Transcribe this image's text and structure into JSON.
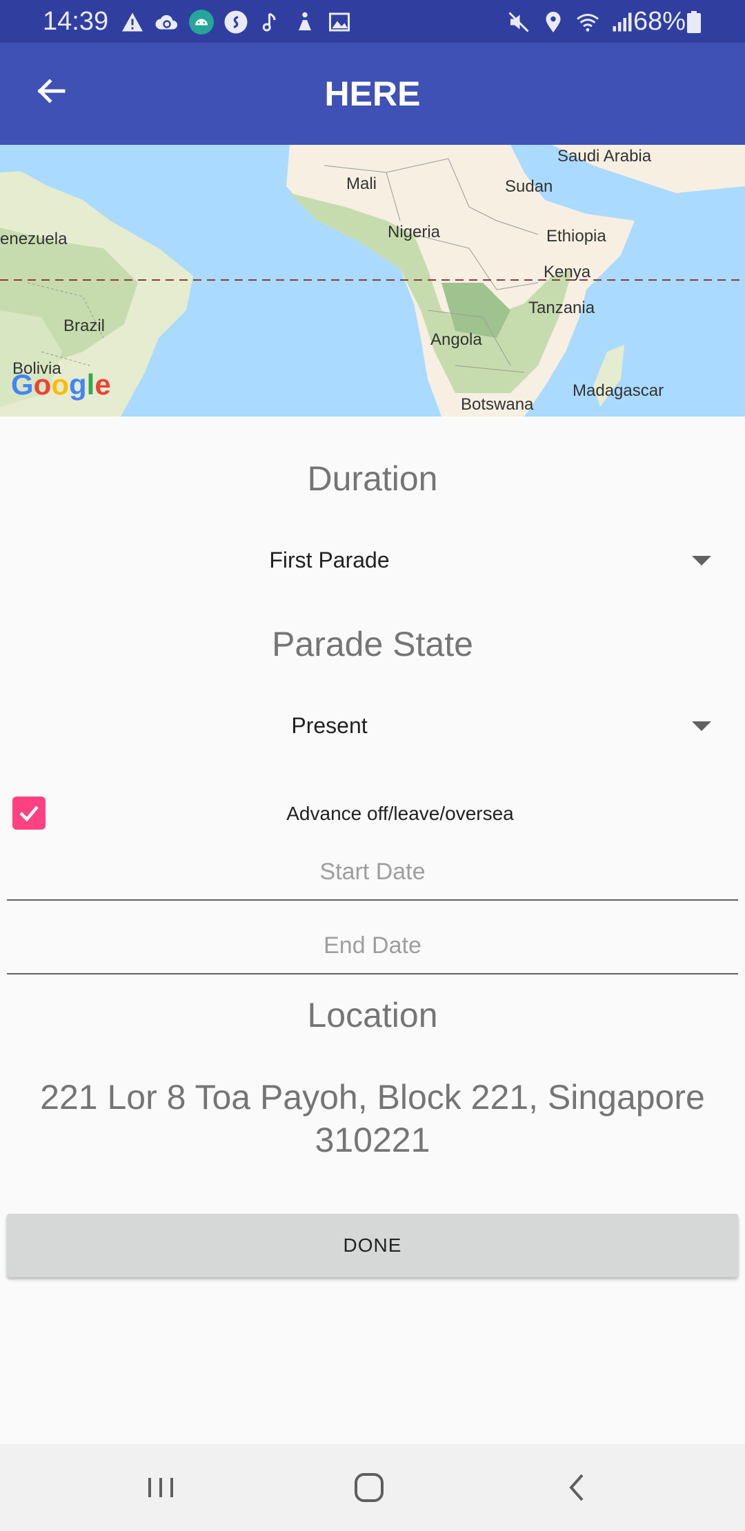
{
  "status_bar": {
    "time": "14:39",
    "battery": "68%",
    "left_icons": [
      "warning-icon",
      "cloud-sync-icon",
      "android-icon",
      "shazam-icon",
      "music-note-icon",
      "accessibility-icon",
      "image-icon"
    ],
    "right_icons": [
      "mute-icon",
      "location-icon",
      "wifi-icon",
      "signal-icon"
    ]
  },
  "app_bar": {
    "title": "HERE",
    "back_icon": "arrow-back-icon"
  },
  "map": {
    "labels": {
      "saudi_arabia": "Saudi Arabia",
      "mali": "Mali",
      "sudan": "Sudan",
      "venezuela": "enezuela",
      "nigeria": "Nigeria",
      "ethiopia": "Ethiopia",
      "kenya": "Kenya",
      "brazil": "Brazil",
      "tanzania": "Tanzania",
      "angola": "Angola",
      "bolivia": "Bolivia",
      "botswana": "Botswana",
      "madagascar": "Madagascar"
    },
    "logo": "Google"
  },
  "form": {
    "duration_title": "Duration",
    "duration_value": "First Parade",
    "parade_state_title": "Parade State",
    "parade_state_value": "Present",
    "checkbox_label": "Advance off/leave/oversea",
    "checkbox_checked": true,
    "start_date_placeholder": "Start Date",
    "end_date_placeholder": "End Date",
    "location_title": "Location",
    "address_line1": "221 Lor 8 Toa Payoh, Block 221, Singapore",
    "address_line2": "310221",
    "done_label": "DONE"
  },
  "colors": {
    "status_bar": "#303f9f",
    "app_bar": "#3f51b5",
    "checkbox_accent": "#ff4081",
    "ocean": "#aadaff"
  }
}
